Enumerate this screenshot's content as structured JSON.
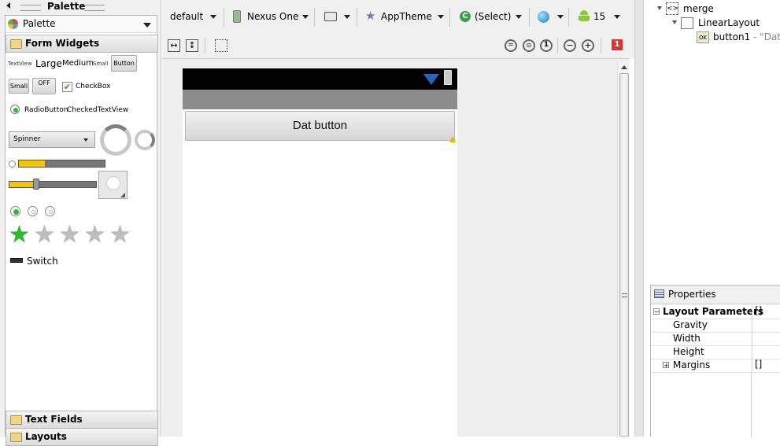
{
  "palette": {
    "header_title": "Palette",
    "dropdown_label": "Palette",
    "form_widgets_label": "Form Widgets",
    "widgets": {
      "textview": "TextView",
      "large": "Large",
      "medium": "Medium",
      "small": "Small",
      "button": "Button",
      "small_button": "Small",
      "toggle_off": "OFF",
      "checkbox": "CheckBox",
      "radiobutton": "RadioButton",
      "checked_textview": "CheckedTextView",
      "spinner": "Spinner",
      "switch": "Switch"
    },
    "text_fields_label": "Text Fields",
    "layouts_label": "Layouts"
  },
  "toolbar": {
    "config": "default",
    "device": "Nexus One",
    "theme": "AppTheme",
    "activity": "(Select)",
    "api_level": "15",
    "error_badge": "1"
  },
  "canvas": {
    "dat_button_label": "Dat button"
  },
  "outline": {
    "root": "merge",
    "child": "LinearLayout",
    "leaf": "button1",
    "leaf_suffix": " - \"Dat b"
  },
  "properties": {
    "title": "Properties",
    "rows": [
      {
        "name": "Layout Parameters",
        "value": "[]"
      },
      {
        "name": "Gravity",
        "value": ""
      },
      {
        "name": "Width",
        "value": ""
      },
      {
        "name": "Height",
        "value": ""
      },
      {
        "name": "Margins",
        "value": "[]"
      }
    ]
  },
  "colors": {
    "progress": "#f4c400",
    "star_active": "#2dbb2d",
    "error": "#e0322a"
  }
}
